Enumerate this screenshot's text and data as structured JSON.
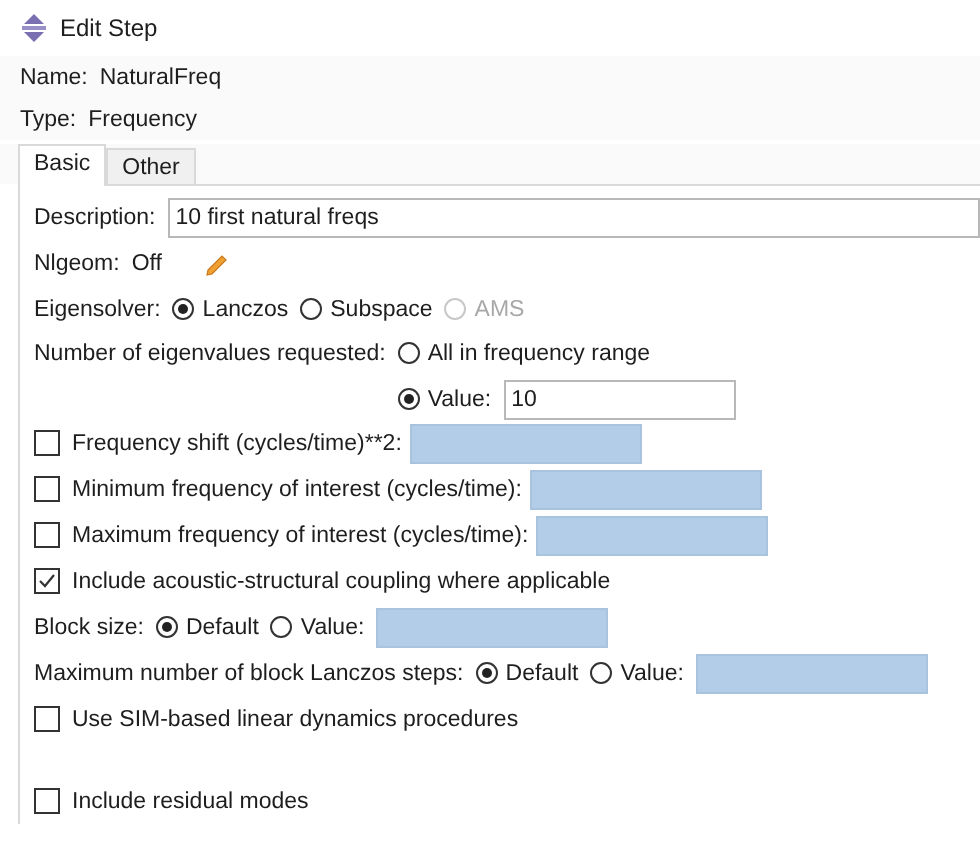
{
  "window": {
    "title": "Edit Step"
  },
  "header": [
    {
      "label": "Name:",
      "value": "NaturalFreq"
    },
    {
      "label": "Type:",
      "value": "Frequency"
    }
  ],
  "tabs": [
    {
      "label": "Basic",
      "selected": true
    },
    {
      "label": "Other",
      "selected": false
    }
  ],
  "rows": [
    {
      "kind": "text_field",
      "label": "Description:",
      "value": "10 first natural freqs"
    },
    {
      "kind": "info",
      "label": "Nlgeom:",
      "value": "Off",
      "editable": true
    },
    {
      "kind": "radio_group",
      "label": "Eigensolver:",
      "options": [
        {
          "label": "Lanczos",
          "selected": true,
          "disabled": false
        },
        {
          "label": "Subspace",
          "selected": false,
          "disabled": false
        },
        {
          "label": "AMS",
          "selected": false,
          "disabled": true
        }
      ]
    },
    {
      "kind": "radio_stack",
      "label": "Number of eigenvalues requested:",
      "options": [
        {
          "label": "All in frequency range",
          "selected": false,
          "disabled": false
        },
        {
          "label": "Value:",
          "selected": true,
          "disabled": false,
          "field": {
            "value": "10",
            "disabled": false
          }
        }
      ]
    },
    {
      "kind": "checkbox",
      "label": "Frequency shift (cycles/time)**2:",
      "checked": false,
      "field": {
        "disabled": true
      }
    },
    {
      "kind": "checkbox",
      "label": "Minimum frequency of interest (cycles/time):",
      "checked": false,
      "field": {
        "disabled": true
      }
    },
    {
      "kind": "checkbox",
      "label": "Maximum frequency of interest (cycles/time):",
      "checked": false,
      "field": {
        "disabled": true
      }
    },
    {
      "kind": "checkbox",
      "label": "Include acoustic-structural coupling where applicable",
      "checked": true
    },
    {
      "kind": "radio_group",
      "label": "Block size:",
      "options": [
        {
          "label": "Default",
          "selected": true,
          "disabled": false
        },
        {
          "label": "Value:",
          "selected": false,
          "disabled": false,
          "field": {
            "disabled": true
          }
        }
      ]
    },
    {
      "kind": "radio_group",
      "label": "Maximum number of block Lanczos steps:",
      "options": [
        {
          "label": "Default",
          "selected": true,
          "disabled": false
        },
        {
          "label": "Value:",
          "selected": false,
          "disabled": false,
          "field": {
            "disabled": true
          }
        }
      ]
    },
    {
      "kind": "checkbox",
      "label": "Use SIM-based linear dynamics procedures",
      "checked": false
    },
    {
      "kind": "checkbox",
      "label": "Include residual modes",
      "checked": false
    }
  ]
}
